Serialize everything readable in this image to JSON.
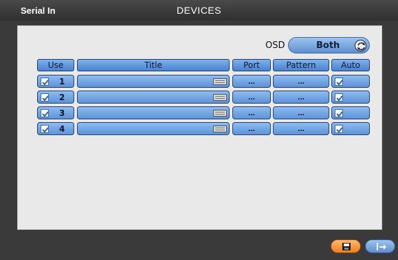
{
  "header": {
    "section": "Serial In",
    "title": "DEVICES"
  },
  "osd": {
    "label": "OSD",
    "value": "Both"
  },
  "columns": {
    "use": "Use",
    "title": "Title",
    "port": "Port",
    "pattern": "Pattern",
    "auto": "Auto"
  },
  "rows": [
    {
      "number": "1",
      "use": true,
      "title": "",
      "port": "...",
      "pattern": "...",
      "auto": true
    },
    {
      "number": "2",
      "use": true,
      "title": "",
      "port": "...",
      "pattern": "...",
      "auto": true
    },
    {
      "number": "3",
      "use": true,
      "title": "",
      "port": "...",
      "pattern": "...",
      "auto": true
    },
    {
      "number": "4",
      "use": true,
      "title": "",
      "port": "...",
      "pattern": "...",
      "auto": true
    }
  ],
  "icons": {
    "osd": "cycle-icon",
    "save": "save-icon",
    "exit": "exit-icon",
    "keyboard": "keyboard-icon",
    "check": "checkmark-icon"
  },
  "colors": {
    "accent": "#5e8fce",
    "save": "#f07f1a",
    "background": "#3a3a3a"
  }
}
